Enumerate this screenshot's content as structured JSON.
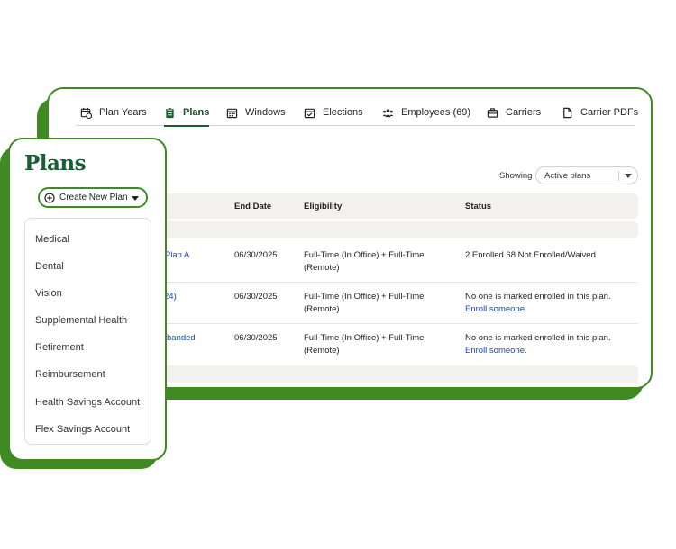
{
  "tabs": [
    {
      "label": "Plan Years",
      "icon": "calendar-clock-icon"
    },
    {
      "label": "Plans",
      "icon": "clipboard-icon",
      "active": true
    },
    {
      "label": "Windows",
      "icon": "calendar-grid-icon"
    },
    {
      "label": "Elections",
      "icon": "calendar-check-icon"
    },
    {
      "label": "Employees (69)",
      "icon": "people-icon"
    },
    {
      "label": "Carriers",
      "icon": "briefcase-icon"
    },
    {
      "label": "Carrier PDFs",
      "icon": "document-icon"
    }
  ],
  "filter": {
    "label": "Showing",
    "value": "Active plans"
  },
  "table": {
    "headers": [
      "End Date",
      "Eligibility",
      "Status"
    ],
    "rows": [
      {
        "plan": "h Plan A",
        "end": "06/30/2025",
        "elig1": "Full-Time (In Office) + Full-Time",
        "elig2": "(Remote)",
        "status": "2 Enrolled 68 Not Enrolled/Waived",
        "action": ""
      },
      {
        "plan": "24)",
        "end": "06/30/2025",
        "elig1": "Full-Time (In Office) + Full-Time",
        "elig2": "(Remote)",
        "status": "No one is marked enrolled in this plan.",
        "action": "Enroll someone."
      },
      {
        "plan": "banded",
        "end": "06/30/2025",
        "elig1": "Full-Time (In Office) + Full-Time",
        "elig2": "(Remote)",
        "status": "No one is marked enrolled in this plan.",
        "action": "Enroll someone."
      }
    ]
  },
  "front": {
    "title": "Plans",
    "create_label": "Create New Plan",
    "menu": [
      "Medical",
      "Dental",
      "Vision",
      "Supplemental Health",
      "Retirement",
      "Reimbursement",
      "Health Savings Account",
      "Flex Savings Account"
    ]
  },
  "colors": {
    "brand_green": "#3f8a22",
    "dark_green": "#1a5e33",
    "link_blue": "#1747c9"
  }
}
